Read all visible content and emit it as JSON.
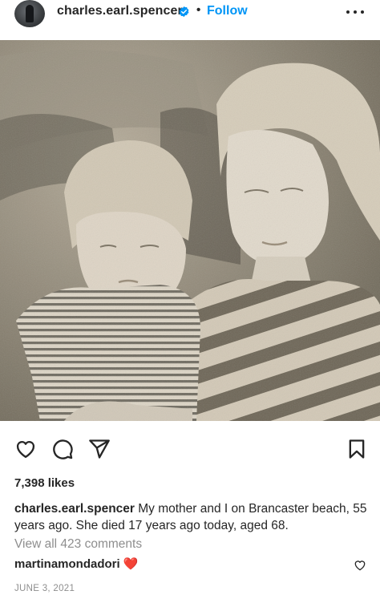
{
  "header": {
    "username": "charles.earl.spencer",
    "separator": "•",
    "follow_label": "Follow",
    "verified_icon": "verified-badge-icon",
    "more_icon": "more-options-icon"
  },
  "actions": {
    "like_icon": "heart-icon",
    "comment_icon": "comment-icon",
    "share_icon": "send-icon",
    "save_icon": "bookmark-icon"
  },
  "post": {
    "likes": "7,398 likes",
    "caption_user": "charles.earl.spencer",
    "caption_text": "My mother and I on Brancaster beach, 55 years ago. She died 17 years ago today, aged 68.",
    "view_comments": "View all 423 comments",
    "comment_user": "martinamondadori",
    "comment_text": "❤️",
    "date": "JUNE 3, 2021"
  },
  "colors": {
    "accent": "#0095f6",
    "text": "#262626",
    "muted": "#8e8e8e",
    "heart": "#ed4956"
  }
}
